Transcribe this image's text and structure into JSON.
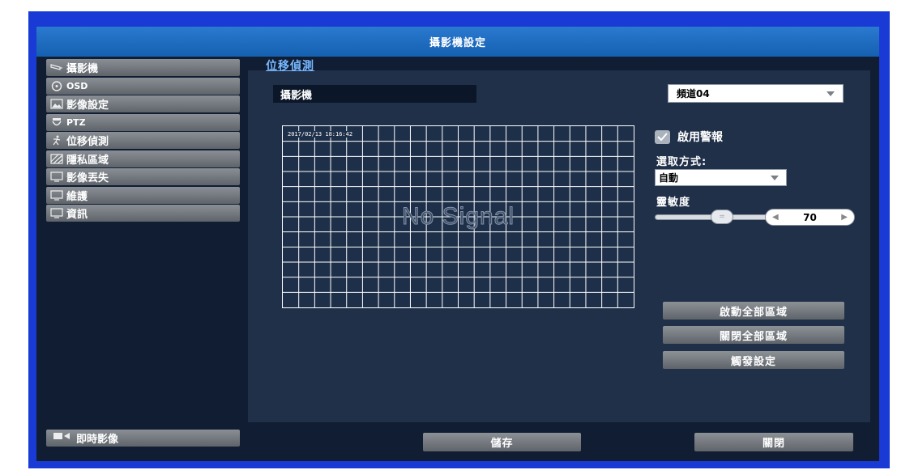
{
  "window": {
    "title": "攝影機設定"
  },
  "sidebar": {
    "items": [
      {
        "label": "攝影機",
        "icon": "camera-icon"
      },
      {
        "label": "OSD",
        "icon": "osd-icon"
      },
      {
        "label": "影像設定",
        "icon": "image-icon"
      },
      {
        "label": "PTZ",
        "icon": "ptz-icon"
      },
      {
        "label": "位移偵測",
        "icon": "motion-icon"
      },
      {
        "label": "隱私區域",
        "icon": "privacy-icon"
      },
      {
        "label": "影像丟失",
        "icon": "monitor-icon"
      },
      {
        "label": "維護",
        "icon": "monitor-icon"
      },
      {
        "label": "資訊",
        "icon": "monitor-icon"
      }
    ],
    "live_label": "即時影像"
  },
  "main": {
    "tab_label": "位移偵測",
    "camera_label": "攝影機",
    "channel_value": "頻道04",
    "grid_timestamp": "2017/02/13 18:16:42",
    "no_signal": "No Signal",
    "alarm_label": "啟用警報",
    "alarm_checked": true,
    "select_mode_label": "選取方式:",
    "select_mode_value": "自動",
    "sensitivity_label": "靈敏度",
    "sensitivity_value": "70",
    "buttons": {
      "enable_all": "啟動全部區域",
      "disable_all": "關閉全部區域",
      "trigger": "觸發設定"
    }
  },
  "footer": {
    "save_label": "儲存",
    "close_label": "關閉"
  },
  "colors": {
    "accent": "#1a3ad6",
    "titlebar": "#2a7ad0",
    "panel": "#203049",
    "link": "#78b8ff"
  }
}
